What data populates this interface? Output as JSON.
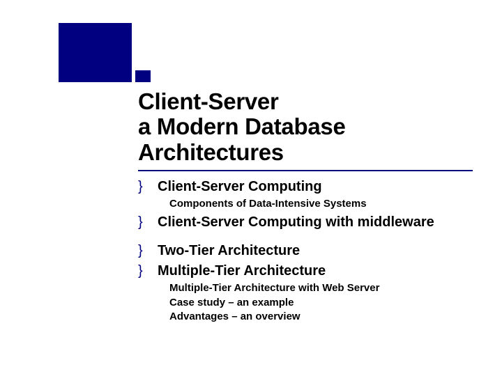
{
  "title": {
    "line1": "Client-Server",
    "line2": "a Modern Database",
    "line3": "Architectures"
  },
  "bullets": [
    {
      "text": "Client-Server Computing",
      "subs": [
        "Components of Data-Intensive Systems"
      ]
    },
    {
      "text": "Client-Server Computing with middleware",
      "subs": [],
      "gapAfter": true
    },
    {
      "text": "Two-Tier Architecture",
      "subs": []
    },
    {
      "text": "Multiple-Tier Architecture",
      "subs": [
        "Multiple-Tier Architecture with Web Server",
        "Case study – an example",
        "Advantages – an overview"
      ]
    }
  ],
  "bulletGlyph": "}"
}
